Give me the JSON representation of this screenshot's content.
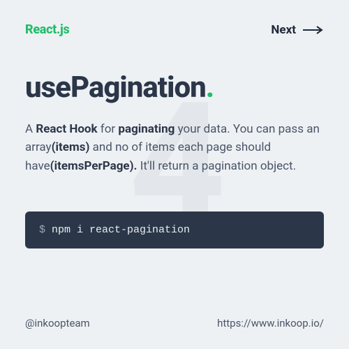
{
  "header": {
    "brand": "React.js",
    "next_label": "Next"
  },
  "bg_number": "4",
  "title": {
    "text": "usePagination",
    "dot": "."
  },
  "description": {
    "part1": "A ",
    "bold1": "React Hook",
    "part2": " for ",
    "bold2": "paginating",
    "part3": " your data. You can pass an array",
    "bold3": "(items)",
    "part4": " and no of items each page should have",
    "bold4": "(itemsPerPage).",
    "part5": " It'll return a pagination object."
  },
  "code": {
    "prompt": "$ ",
    "command": "npm i react-pagination"
  },
  "footer": {
    "handle": "@inkoopteam",
    "url": "https://www.inkoop.io/"
  }
}
